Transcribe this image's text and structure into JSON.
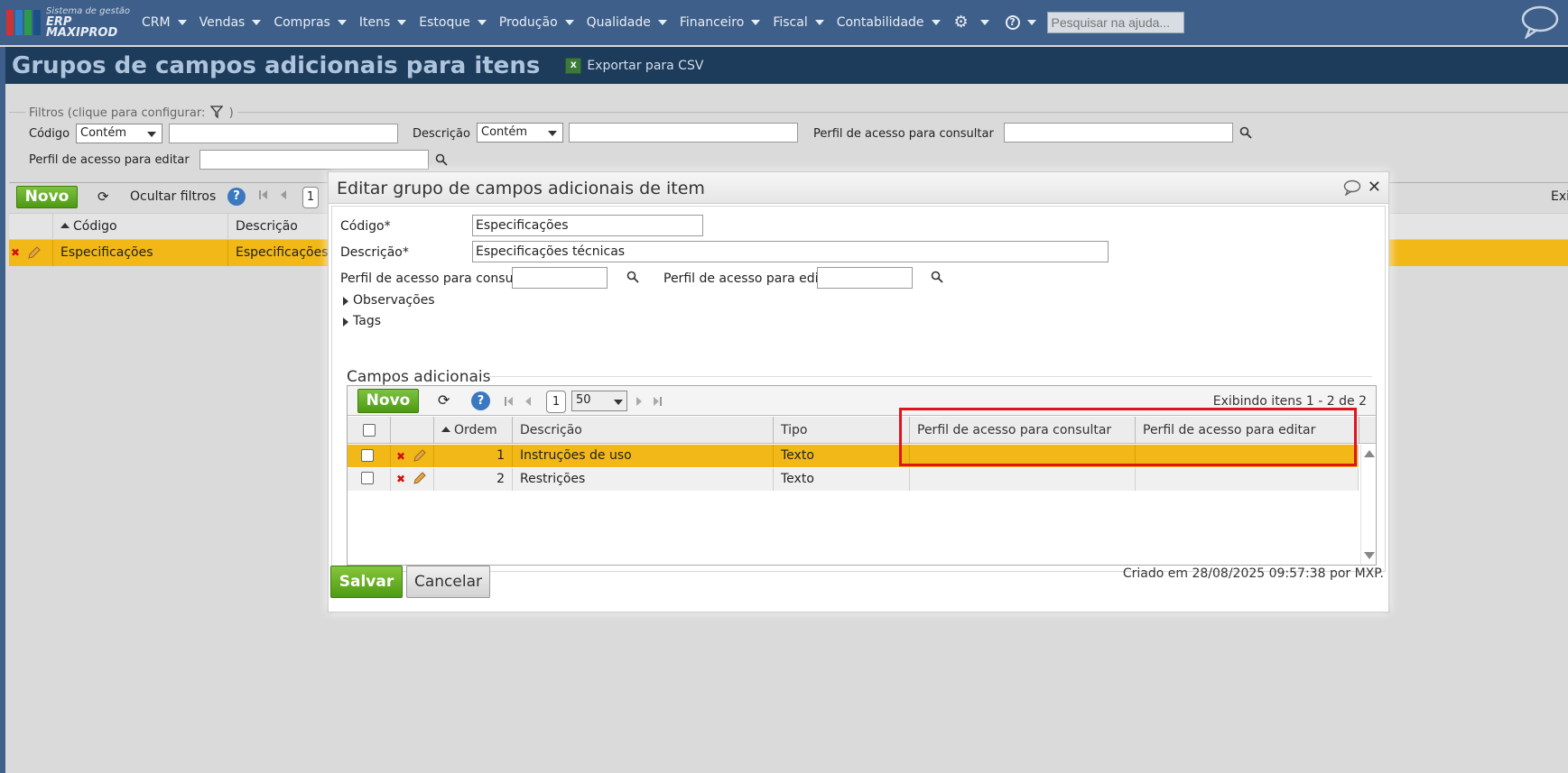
{
  "app": {
    "logo_line1": "Sistema de gestão",
    "logo_line2": "ERP MAXIPROD",
    "menu": [
      "CRM",
      "Vendas",
      "Compras",
      "Itens",
      "Estoque",
      "Produção",
      "Qualidade",
      "Financeiro",
      "Fiscal",
      "Contabilidade"
    ],
    "search_placeholder": "Pesquisar na ajuda..."
  },
  "page": {
    "title": "Grupos de campos adicionais para itens",
    "export_label": "Exportar para CSV",
    "filters": {
      "legend": "Filtros (clique para configurar:",
      "legend_end": ")",
      "codigo_label": "Código",
      "codigo_op": "Contém",
      "descricao_label": "Descrição",
      "descricao_op": "Contém",
      "perfil_consultar_label": "Perfil de acesso para consultar",
      "perfil_editar_label": "Perfil de acesso para editar"
    },
    "toolbar": {
      "novo": "Novo",
      "ocultar_filtros": "Ocultar filtros",
      "page": "1",
      "right_text": "Exi"
    },
    "grid": {
      "col_codigo": "Código",
      "col_descricao": "Descrição",
      "row_codigo": "Especificações",
      "row_descricao": "Especificações te"
    }
  },
  "modal": {
    "title": "Editar grupo de campos adicionais de item",
    "codigo_label": "Código*",
    "codigo_value": "Especificações",
    "descricao_label": "Descrição*",
    "descricao_value": "Especificações técnicas",
    "perfil_consultar_label": "Perfil de acesso para consultar",
    "perfil_editar_label": "Perfil de acesso para editar",
    "observacoes": "Observações",
    "tags": "Tags",
    "section_title": "Campos adicionais",
    "grid": {
      "novo": "Novo",
      "page": "1",
      "page_size": "50",
      "info": "Exibindo itens 1 - 2 de 2",
      "columns": [
        "Ordem",
        "Descrição",
        "Tipo",
        "Perfil de acesso para consultar",
        "Perfil de acesso para editar"
      ],
      "rows": [
        {
          "ordem": "1",
          "descricao": "Instruções de uso",
          "tipo": "Texto",
          "consultar": "",
          "editar": ""
        },
        {
          "ordem": "2",
          "descricao": "Restrições",
          "tipo": "Texto",
          "consultar": "",
          "editar": ""
        }
      ]
    },
    "salvar": "Salvar",
    "cancelar": "Cancelar",
    "created": "Criado em 28/08/2025 09:57:38 por MXP."
  },
  "colors": {
    "topbar": "#3e5f8a",
    "titlebar": "#1d3b5a",
    "selected_row": "#f1b818",
    "green_button": "#5aa81c",
    "highlight": "#e0141e"
  }
}
